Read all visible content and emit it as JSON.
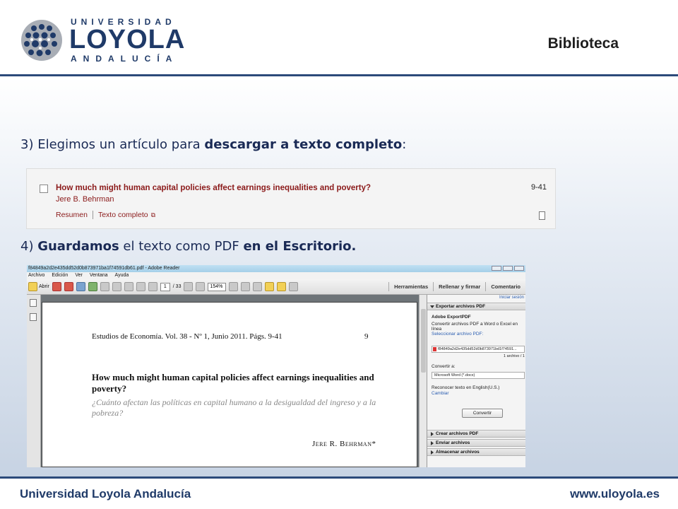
{
  "header": {
    "logo_top": "UNIVERSIDAD",
    "logo_main": "LOYOLA",
    "logo_bottom": "ANDALUCÍA",
    "title": "Biblioteca"
  },
  "steps": {
    "step3": {
      "prefix": "3) Elegimos un artículo para ",
      "bold": "descargar a texto completo",
      "suffix": ":"
    },
    "step4": {
      "prefix": "4) ",
      "bold1": "Guardamos",
      "middle": " el texto como PDF ",
      "bold2": "en el Escritorio."
    }
  },
  "result": {
    "title": "How much might human capital policies affect earnings inequalities and poverty?",
    "author": "Jere B. Behrman",
    "link_abstract": "Resumen",
    "link_fulltext": "Texto completo",
    "pages": "9-41"
  },
  "reader": {
    "window_title": "f84849a2d2e435dd52d0b873971ba1f74591db61.pdf - Adobe Reader",
    "menu": [
      "Archivo",
      "Edición",
      "Ver",
      "Ventana",
      "Ayuda"
    ],
    "toolbar": {
      "open_label": "Abrir",
      "page_current": "1",
      "page_total": "/ 33",
      "zoom": "154%",
      "tabs": [
        "Herramientas",
        "Rellenar y firmar",
        "Comentario"
      ]
    },
    "page": {
      "journal": "Estudios de Economía. Vol. 38 - Nº 1, Junio 2011. Págs. 9-41",
      "page_number": "9",
      "title": "How much might human capital policies affect earnings inequalities and poverty?",
      "subtitle": "¿Cuánto afectan las políticas en capital humano a la desigualdad del ingreso y a la pobreza?",
      "author": "Jere R. Behrman*"
    },
    "pane": {
      "login": "Iniciar sesión",
      "export_header": "Exportar archivos PDF",
      "service": "Adobe ExportPDF",
      "service_desc": "Convertir archivos PDF a Word o Excel en línea",
      "select_label": "Seleccionar archivo PDF:",
      "file_name": "f84849a2d2e435dd52d0b873971bd1f74591...",
      "file_count": "1 archivo / 1",
      "convert_to_label": "Convertir a:",
      "convert_to_value": "Microsoft Word (*.docx)",
      "ocr_label": "Reconocer texto en English(U.S.)",
      "ocr_change": "Cambiar",
      "convert_button": "Convertir",
      "create_header": "Crear archivos PDF",
      "send_header": "Enviar archivos",
      "store_header": "Almacenar archivos"
    }
  },
  "footer": {
    "left": "Universidad Loyola Andalucía",
    "right": "www.uloyola.es"
  },
  "colors": {
    "brand": "#1f3a68",
    "rule": "#2c4a7a",
    "result_link": "#8b1a1a"
  }
}
